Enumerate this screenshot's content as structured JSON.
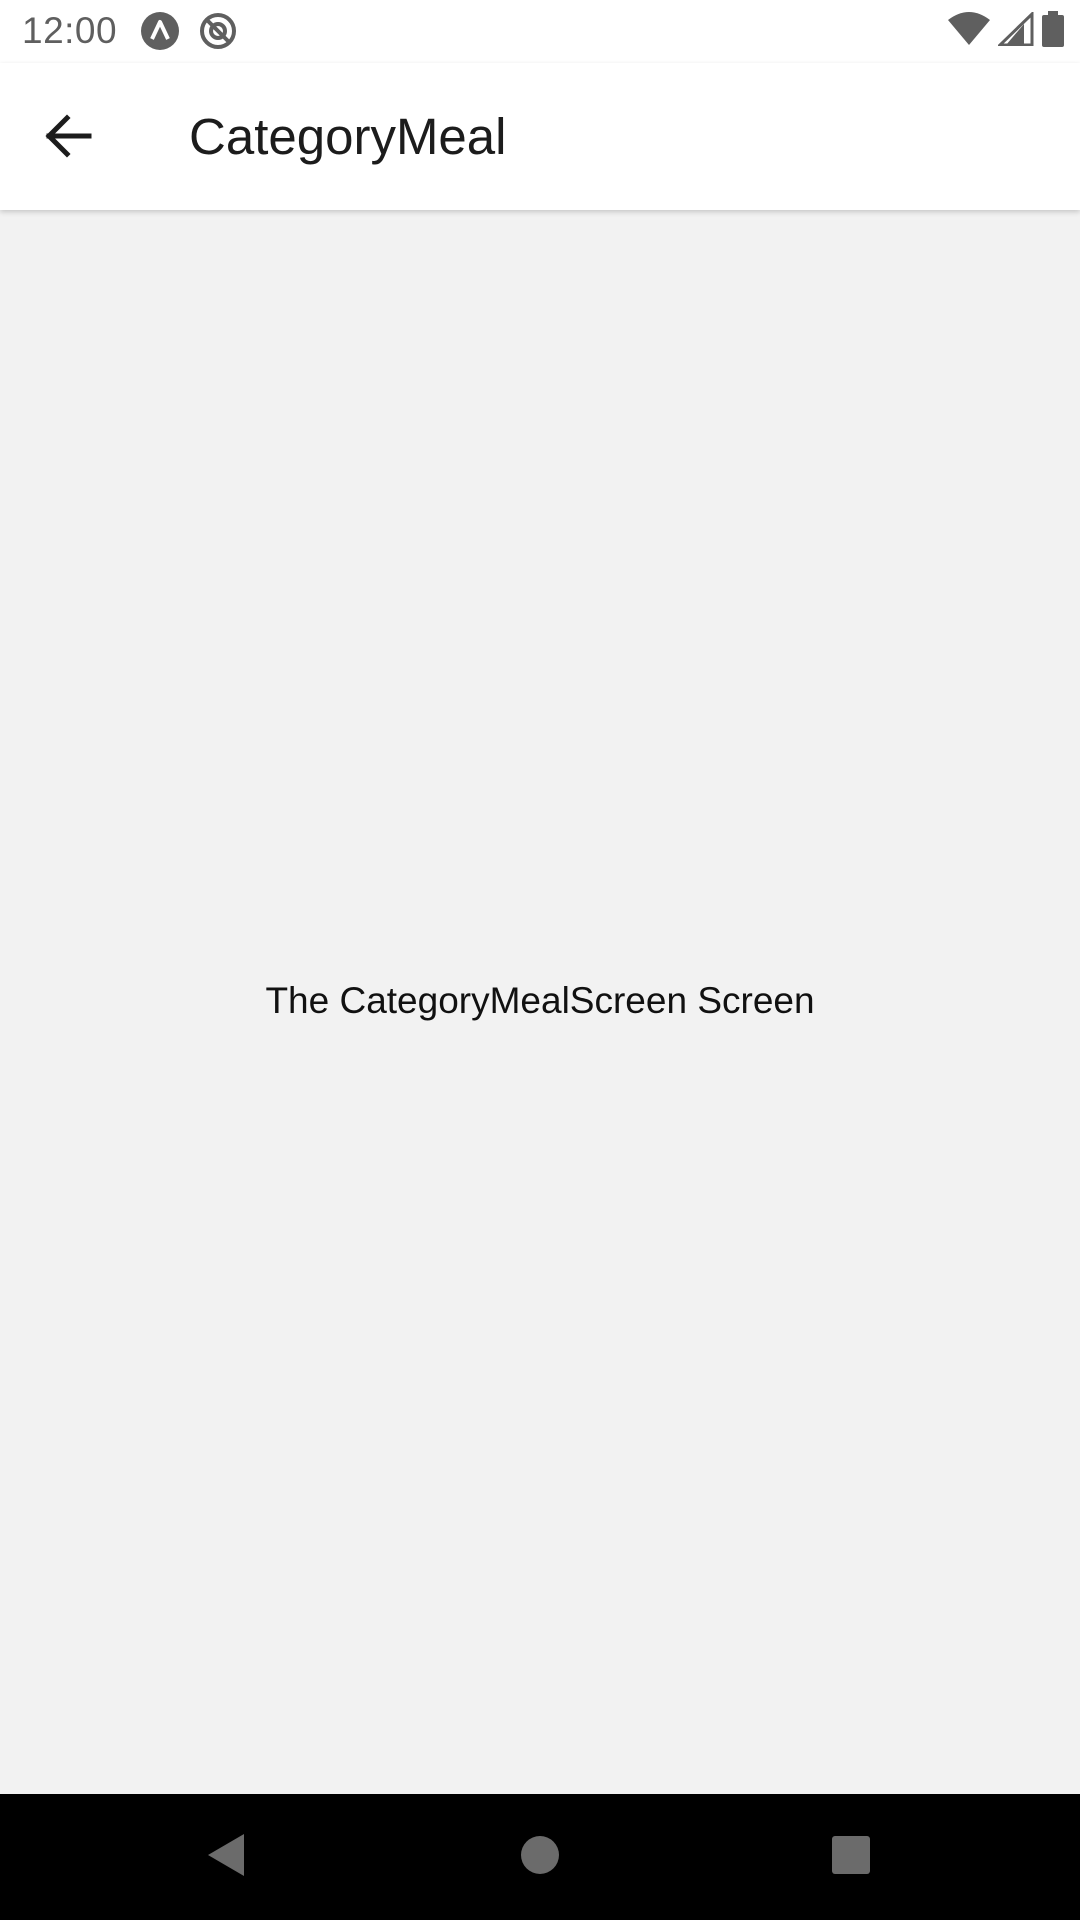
{
  "status_bar": {
    "time": "12:00",
    "left_icons": [
      "app-notification-icon",
      "sync-disabled-icon"
    ],
    "right_icons": [
      "wifi-icon",
      "cell-signal-icon",
      "battery-icon"
    ]
  },
  "app_bar": {
    "title": "CategoryMeal",
    "back_icon": "arrow-back-icon"
  },
  "main": {
    "message": "The CategoryMealScreen Screen"
  },
  "nav_bar": {
    "buttons": [
      "back-triangle-icon",
      "home-circle-icon",
      "recents-square-icon"
    ]
  },
  "colors": {
    "background": "#f2f2f2",
    "app_bar": "#ffffff",
    "nav_bar": "#000000",
    "text": "#1c1c1c"
  }
}
